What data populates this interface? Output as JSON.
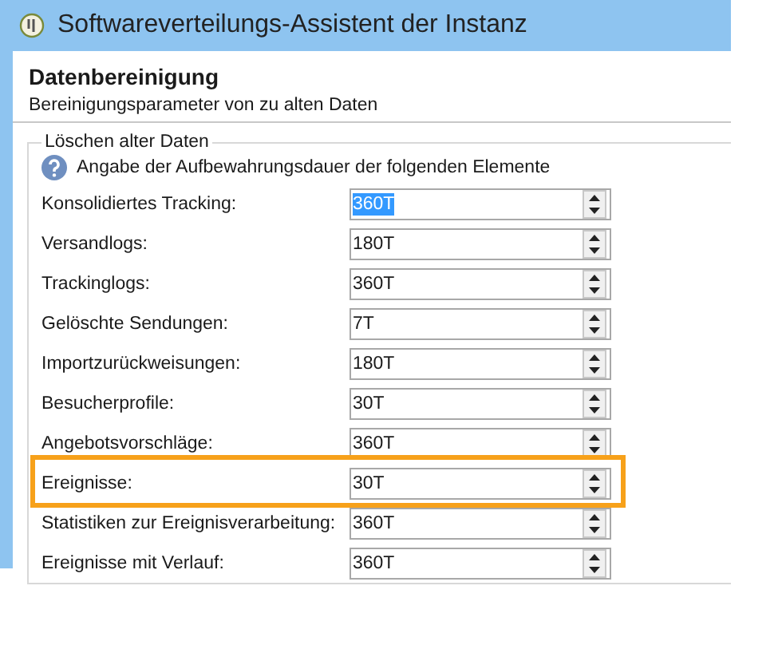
{
  "window": {
    "title": "Softwareverteilungs-Assistent der Instanz"
  },
  "header": {
    "title": "Datenbereinigung",
    "subtitle": "Bereinigungsparameter von zu alten Daten"
  },
  "group": {
    "title": "Löschen alter Daten",
    "hint": "Angabe der Aufbewahrungsdauer der folgenden Elemente",
    "rows": [
      {
        "label": "Konsolidiertes Tracking:",
        "value": "360T",
        "text_selected": true,
        "highlighted": false
      },
      {
        "label": "Versandlogs:",
        "value": "180T",
        "text_selected": false,
        "highlighted": false
      },
      {
        "label": "Trackinglogs:",
        "value": "360T",
        "text_selected": false,
        "highlighted": false
      },
      {
        "label": "Gelöschte Sendungen:",
        "value": "7T",
        "text_selected": false,
        "highlighted": false
      },
      {
        "label": "Importzurückweisungen:",
        "value": "180T",
        "text_selected": false,
        "highlighted": false
      },
      {
        "label": "Besucherprofile:",
        "value": "30T",
        "text_selected": false,
        "highlighted": false
      },
      {
        "label": "Angebotsvorschläge:",
        "value": "360T",
        "text_selected": false,
        "highlighted": false
      },
      {
        "label": "Ereignisse:",
        "value": "30T",
        "text_selected": false,
        "highlighted": true
      },
      {
        "label": "Statistiken zur Ereignisverarbeitung:",
        "value": "360T",
        "text_selected": false,
        "highlighted": false
      },
      {
        "label": "Ereignisse mit Verlauf:",
        "value": "360T",
        "text_selected": false,
        "highlighted": false
      }
    ]
  }
}
